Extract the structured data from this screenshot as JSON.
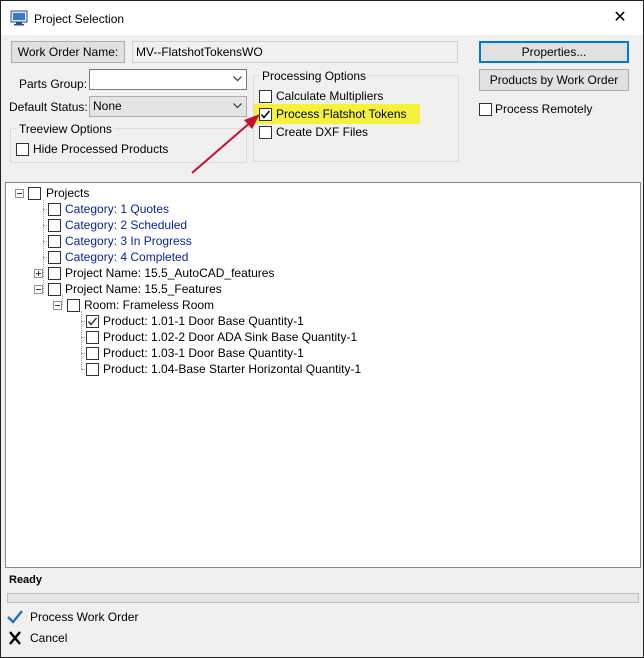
{
  "window": {
    "title": "Project Selection",
    "close_glyph": "✕"
  },
  "header": {
    "work_order_button": "Work Order Name:",
    "work_order_value": "MV--FlatshotTokensWO",
    "properties_button": "Properties...",
    "products_by_work_order_button": "Products by Work Order"
  },
  "filters": {
    "parts_group_label": "Parts Group:",
    "parts_group_value": "",
    "default_status_label": "Default Status:",
    "default_status_value": "None"
  },
  "treeview_options": {
    "title": "Treeview Options",
    "hide_processed_label": "Hide Processed Products",
    "hide_processed_checked": false
  },
  "processing_options": {
    "title": "Processing Options",
    "calculate_multipliers_label": "Calculate Multipliers",
    "calculate_multipliers_checked": false,
    "process_flatshot_label": "Process Flatshot Tokens",
    "process_flatshot_checked": true,
    "create_dxf_label": "Create DXF Files",
    "create_dxf_checked": false,
    "highlight_color": "#f6f13a",
    "arrow_color": "#c8102e"
  },
  "process_remotely": {
    "label": "Process Remotely",
    "checked": false
  },
  "tree": {
    "root": "Projects",
    "categories": [
      "Category: 1 Quotes",
      "Category: 2 Scheduled",
      "Category: 3 In Progress",
      "Category: 4 Completed"
    ],
    "project_1": "Project Name: 15.5_AutoCAD_features",
    "project_2": "Project Name: 15.5_Features",
    "room": "Room: Frameless Room",
    "products": [
      "Product: 1.01-1 Door Base Quantity-1",
      "Product: 1.02-2 Door ADA Sink Base Quantity-1",
      "Product: 1.03-1 Door Base Quantity-1",
      "Product: 1.04-Base Starter Horizontal Quantity-1"
    ],
    "category_text_color": "#0a249f"
  },
  "status": {
    "text": "Ready"
  },
  "actions": {
    "process_label": "Process Work Order",
    "cancel_label": "Cancel"
  }
}
